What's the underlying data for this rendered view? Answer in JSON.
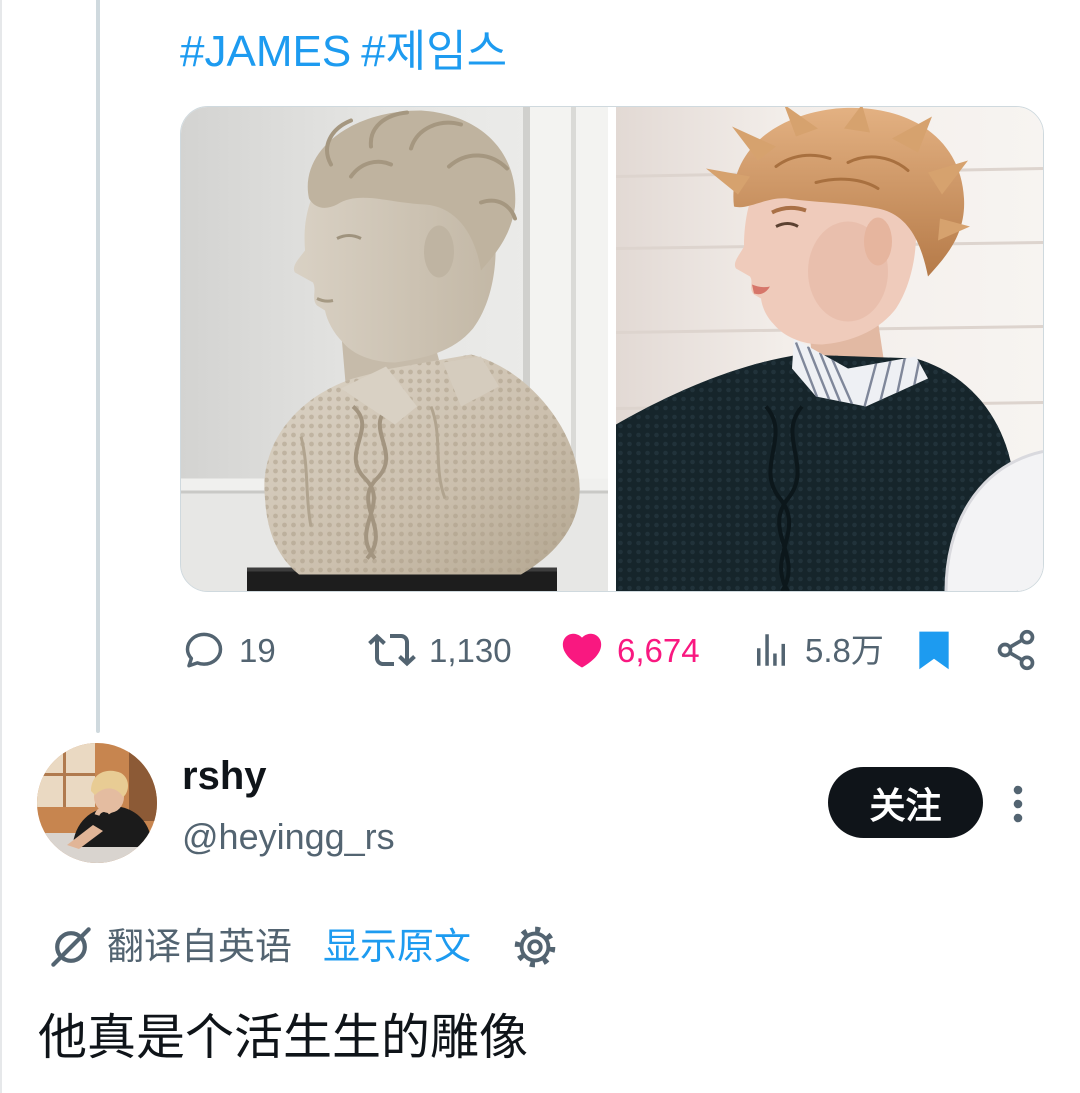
{
  "colors": {
    "text_primary": "#0f1419",
    "text_secondary": "#536471",
    "accent_blue": "#1d9bf0",
    "like_pink": "#f91880",
    "thread_line": "#cfd9de"
  },
  "tweet": {
    "hashtags": [
      "#JAMES",
      "#제임스"
    ],
    "actions": {
      "reply": {
        "icon": "reply-icon",
        "count": "19"
      },
      "retweet": {
        "icon": "retweet-icon",
        "count": "1,130"
      },
      "like": {
        "icon": "heart-icon",
        "count": "6,674",
        "liked": true
      },
      "views": {
        "icon": "views-icon",
        "count": "5.8万"
      },
      "bookmark": {
        "icon": "bookmark-icon",
        "bookmarked": true
      },
      "share": {
        "icon": "share-icon"
      }
    }
  },
  "reply": {
    "author": {
      "name": "rshy",
      "handle": "@heyingg_rs"
    },
    "follow_button": "关注",
    "more_icon": "more-vertical-icon",
    "translation": {
      "icon": "translate-icon",
      "label": "翻译自英语",
      "show_original": "显示原文",
      "settings_icon": "gear-icon"
    },
    "text": "他真是个活生生的雕像"
  }
}
